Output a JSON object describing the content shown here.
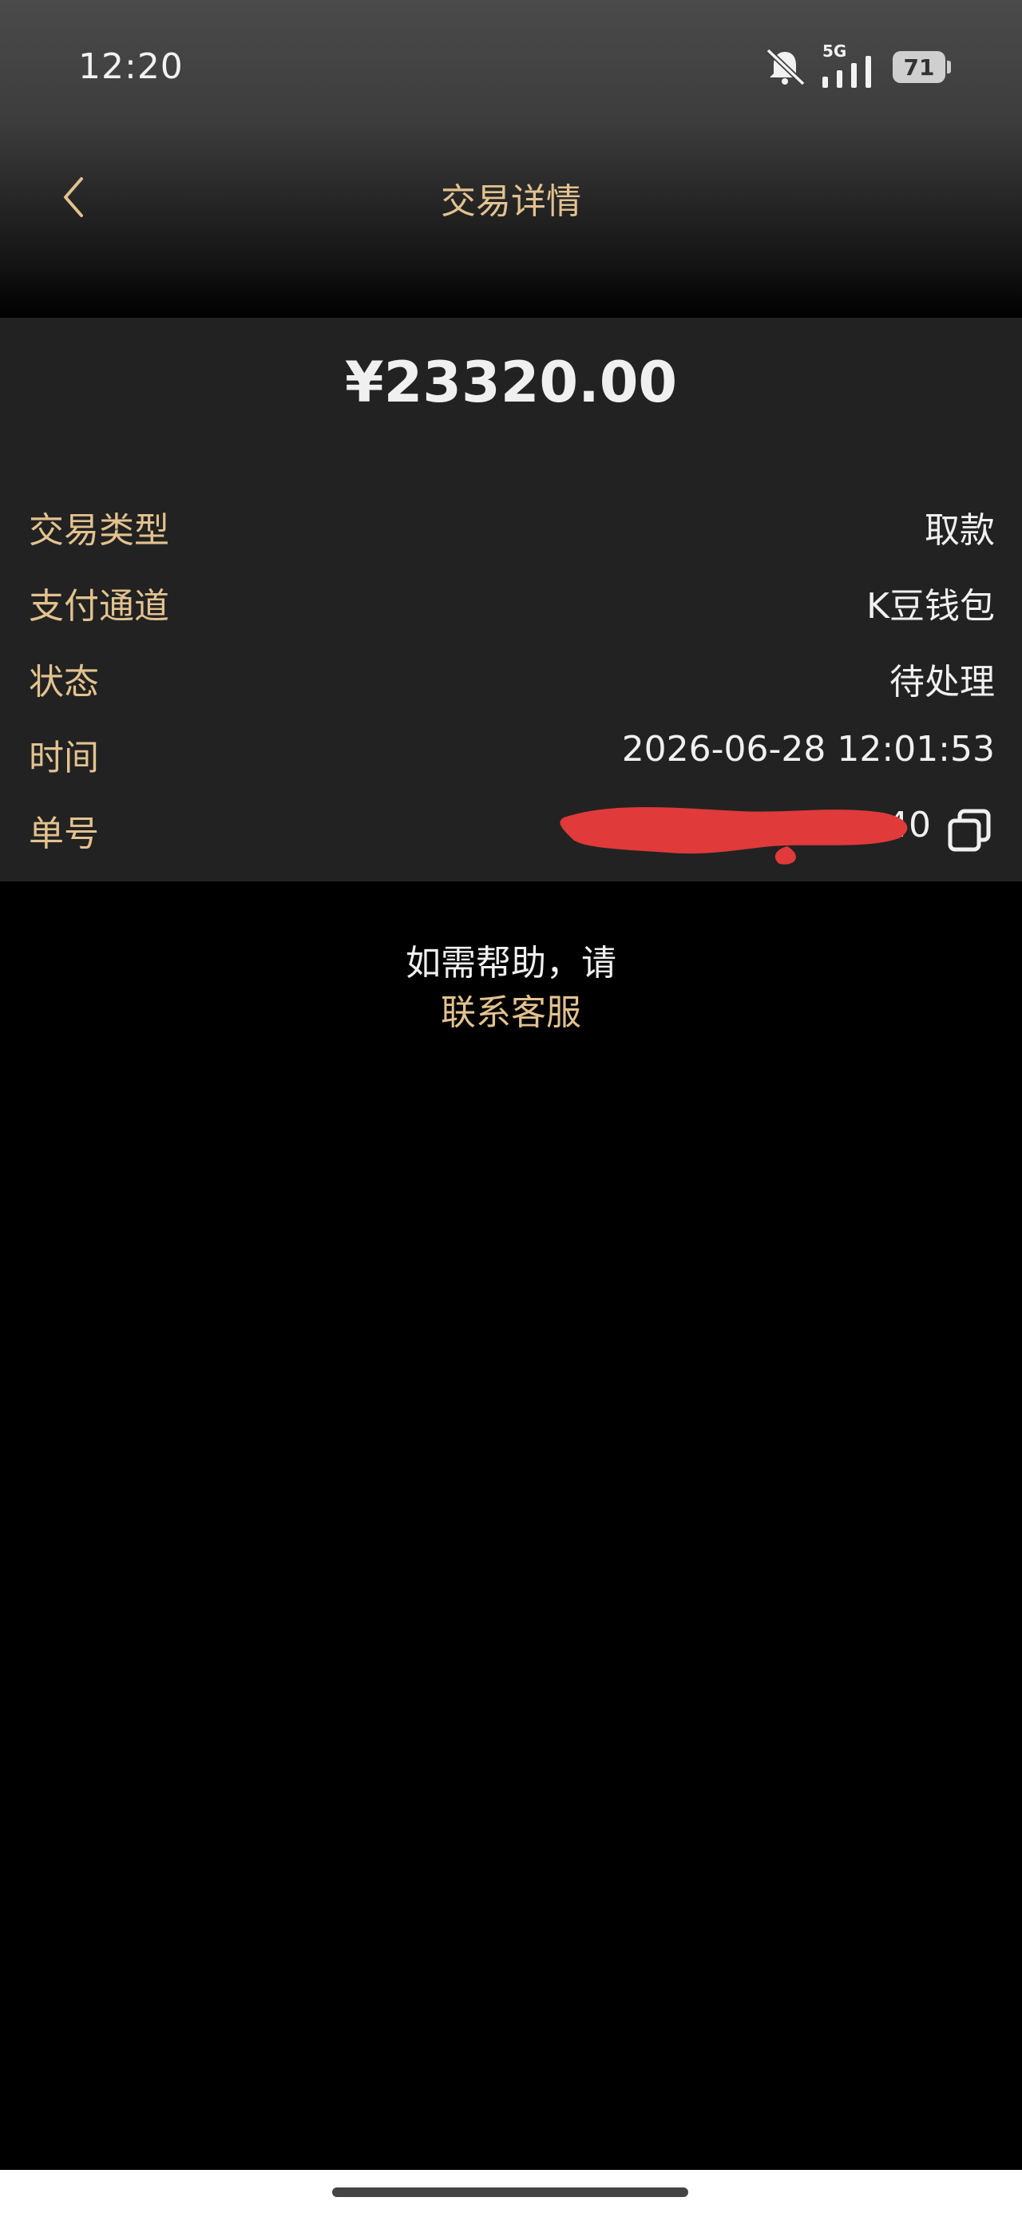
{
  "status_bar": {
    "time": "12:20",
    "network": "5G",
    "battery": "71",
    "icons": [
      "bell-off-icon",
      "signal-icon",
      "battery-icon"
    ]
  },
  "nav": {
    "title": "交易详情",
    "back_icon": "chevron-left-icon"
  },
  "transaction": {
    "amount": "¥23320.00",
    "rows": [
      {
        "label": "交易类型",
        "value": "取款"
      },
      {
        "label": "支付通道",
        "value": "K豆钱包"
      },
      {
        "label": "状态",
        "value": "待处理"
      },
      {
        "label": "时间",
        "value": "2026-06-28 12:01:53"
      }
    ],
    "order": {
      "label": "单号",
      "value": "1                    40",
      "copy_icon": "copy-icon"
    }
  },
  "help": {
    "text": "如需帮助，请",
    "link": "联系客服"
  },
  "colors": {
    "accent": "#e3c28f",
    "card_bg": "#222222",
    "redaction": "#e03a3a"
  }
}
